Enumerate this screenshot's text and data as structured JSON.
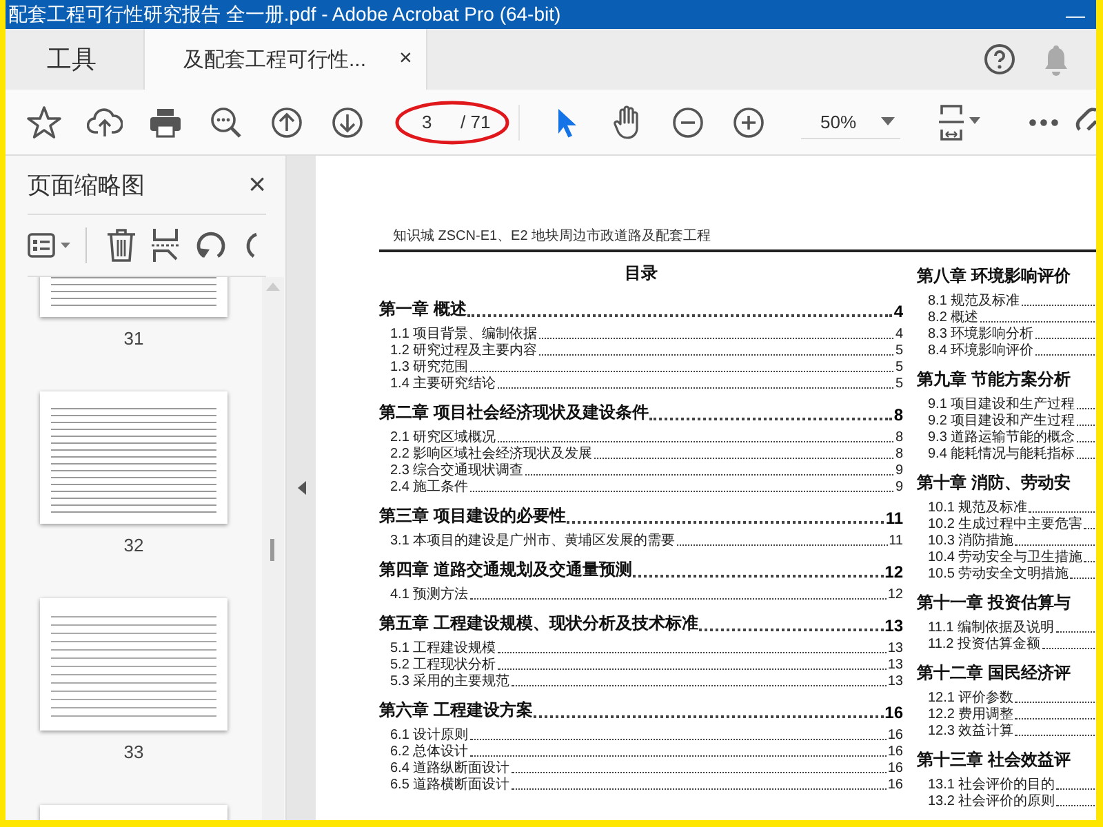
{
  "window": {
    "title": "配套工程可行性研究报告 全一册.pdf - Adobe Acrobat Pro (64-bit)",
    "minimize": "—"
  },
  "tabs": [
    {
      "label": "工具",
      "selected": false
    },
    {
      "label": "及配套工程可行性...",
      "selected": true,
      "close": "×"
    }
  ],
  "toolbar": {
    "page_number": "3",
    "page_total": "/ 71",
    "zoom": "50%",
    "tools": [
      {
        "kind": "select",
        "selected": true
      },
      {
        "kind": "hand",
        "selected": false
      }
    ]
  },
  "sidebar": {
    "title": "页面缩略图",
    "close": "×",
    "thumbnails": [
      {
        "kind": "page",
        "label": "31"
      },
      {
        "kind": "page",
        "label": "32"
      },
      {
        "kind": "page",
        "label": "33"
      },
      {
        "kind": "page"
      }
    ]
  },
  "document": {
    "header": "知识城 ZSCN-E1、E2 地块周边市政道路及配套工程",
    "toc_title": "目录",
    "columns": [
      {
        "chapters": [
          {
            "title": "第一章 概述",
            "page": "4",
            "sections": [
              {
                "title": "1.1 项目背景、编制依据",
                "page": "4"
              },
              {
                "title": "1.2 研究过程及主要内容",
                "page": "5"
              },
              {
                "title": "1.3 研究范围",
                "page": "5"
              },
              {
                "title": "1.4 主要研究结论",
                "page": "5"
              }
            ]
          },
          {
            "title": "第二章 项目社会经济现状及建设条件",
            "page": "8",
            "sections": [
              {
                "title": "2.1 研究区域概况",
                "page": "8"
              },
              {
                "title": "2.2 影响区域社会经济现状及发展",
                "page": "8"
              },
              {
                "title": "2.3 综合交通现状调查",
                "page": "9"
              },
              {
                "title": "2.4 施工条件",
                "page": "9"
              }
            ]
          },
          {
            "title": "第三章 项目建设的必要性",
            "page": "11",
            "sections": [
              {
                "title": "3.1 本项目的建设是广州市、黄埔区发展的需要",
                "page": "11"
              }
            ]
          },
          {
            "title": "第四章 道路交通规划及交通量预测",
            "page": "12",
            "sections": [
              {
                "title": "4.1 预测方法",
                "page": "12"
              }
            ]
          },
          {
            "title": "第五章 工程建设规模、现状分析及技术标准",
            "page": "13",
            "sections": [
              {
                "title": "5.1 工程建设规模",
                "page": "13"
              },
              {
                "title": "5.2 工程现状分析",
                "page": "13"
              },
              {
                "title": "5.3 采用的主要规范",
                "page": "13"
              }
            ]
          },
          {
            "title": "第六章 工程建设方案",
            "page": "16",
            "sections": [
              {
                "title": "6.1 设计原则",
                "page": "16"
              },
              {
                "title": "6.2 总体设计",
                "page": "16"
              },
              {
                "title": "6.4 道路纵断面设计",
                "page": "16"
              },
              {
                "title": "6.5 道路横断面设计",
                "page": "16"
              }
            ]
          }
        ]
      },
      {
        "chapters": [
          {
            "title": "第八章 环境影响评价",
            "sections": [
              {
                "title": "8.1 规范及标准"
              },
              {
                "title": "8.2 概述"
              },
              {
                "title": "8.3 环境影响分析"
              },
              {
                "title": "8.4 环境影响评价"
              }
            ]
          },
          {
            "title": "第九章 节能方案分析",
            "sections": [
              {
                "title": "9.1 项目建设和生产过程"
              },
              {
                "title": "9.2 项目建设和产生过程"
              },
              {
                "title": "9.3 道路运输节能的概念"
              },
              {
                "title": "9.4 能耗情况与能耗指标"
              }
            ]
          },
          {
            "title": "第十章 消防、劳动安",
            "sections": [
              {
                "title": "10.1 规范及标准"
              },
              {
                "title": "10.2 生成过程中主要危害"
              },
              {
                "title": "10.3 消防措施"
              },
              {
                "title": "10.4 劳动安全与卫生措施"
              },
              {
                "title": "10.5 劳动安全文明措施"
              }
            ]
          },
          {
            "title": "第十一章 投资估算与",
            "sections": [
              {
                "title": "11.1 编制依据及说明"
              },
              {
                "title": "11.2 投资估算金额"
              }
            ]
          },
          {
            "title": "第十二章 国民经济评",
            "sections": [
              {
                "title": "12.1 评价参数"
              },
              {
                "title": "12.2 费用调整"
              },
              {
                "title": "12.3 效益计算"
              }
            ]
          },
          {
            "title": "第十三章 社会效益评",
            "sections": [
              {
                "title": "13.1 社会评价的目的"
              },
              {
                "title": "13.2 社会评价的原则"
              }
            ]
          }
        ]
      }
    ]
  }
}
